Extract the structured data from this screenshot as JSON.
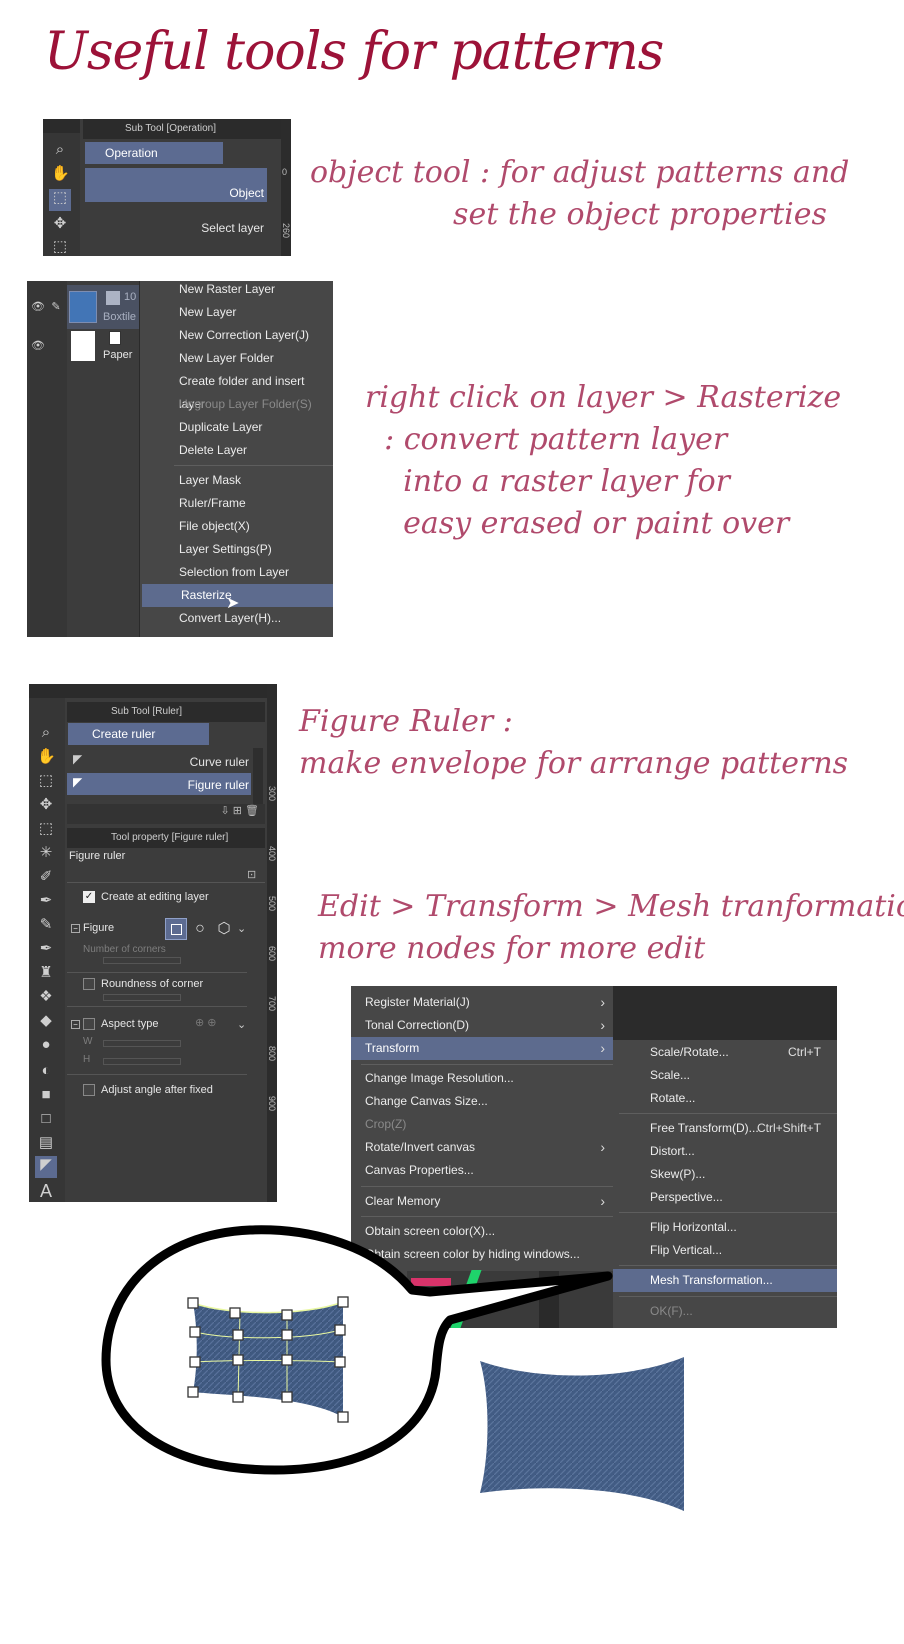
{
  "title": "Useful tools for patterns",
  "notes": {
    "object": "object tool : for adjust patterns and\n               set the object properties",
    "rasterize": "right click on layer > Rasterize\n  : convert pattern layer\n    into a raster layer for\n    easy erased or paint over",
    "figure": "Figure Ruler :\nmake envelope for arrange patterns",
    "mesh": "Edit > Transform > Mesh tranformation\nmore nodes for more edit"
  },
  "panel_object": {
    "header": "Sub Tool [Operation]",
    "group": "Operation",
    "items": [
      "Object",
      "Select layer"
    ],
    "ruler_marks": [
      "0",
      "260"
    ]
  },
  "panel_layers": {
    "layers": [
      {
        "name": "Boxtile",
        "extra": "10"
      },
      {
        "name": "Paper"
      }
    ],
    "menu": [
      "New Raster Layer",
      "New Layer",
      "New Correction Layer(J)",
      "New Layer Folder",
      "Create folder and insert layer",
      "Ungroup Layer Folder(S)",
      "Duplicate Layer",
      "Delete Layer",
      "Layer Mask",
      "Ruler/Frame",
      "File object(X)",
      "Layer Settings(P)",
      "Selection from Layer",
      "Rasterize",
      "Convert Layer(H)..."
    ]
  },
  "panel_ruler": {
    "header": "Sub Tool [Ruler]",
    "group": "Create ruler",
    "items": [
      "Curve ruler",
      "Figure ruler"
    ],
    "prop_header": "Tool property [Figure ruler]",
    "prop_title": "Figure ruler",
    "create_at_editing": "Create at editing layer",
    "figure_label": "Figure",
    "corners_label": "Number of corners",
    "roundness_label": "Roundness of corner",
    "aspect_label": "Aspect type",
    "w_label": "W",
    "h_label": "H",
    "adjust_label": "Adjust angle after fixed",
    "ruler_marks": [
      "300",
      "400",
      "500",
      "600",
      "700",
      "800",
      "900"
    ]
  },
  "edit_menu": {
    "left": [
      {
        "label": "Register Material(J)",
        "sub": true
      },
      {
        "label": "Tonal Correction(D)",
        "sub": true
      },
      {
        "label": "Transform",
        "sub": true,
        "hl": true
      },
      {
        "label": "Change Image Resolution..."
      },
      {
        "label": "Change Canvas Size..."
      },
      {
        "label": "Crop(Z)",
        "dis": true
      },
      {
        "label": "Rotate/Invert canvas",
        "sub": true
      },
      {
        "label": "Canvas Properties..."
      },
      {
        "label": "Clear Memory",
        "sub": true
      },
      {
        "label": "Obtain screen color(X)..."
      },
      {
        "label": "Obtain screen color by hiding windows..."
      }
    ],
    "right": [
      {
        "label": "Scale/Rotate...",
        "shortcut": "Ctrl+T"
      },
      {
        "label": "Scale..."
      },
      {
        "label": "Rotate..."
      },
      {
        "label": "Free Transform(D)...",
        "shortcut": "Ctrl+Shift+T"
      },
      {
        "label": "Distort..."
      },
      {
        "label": "Skew(P)..."
      },
      {
        "label": "Perspective..."
      },
      {
        "label": "Flip Horizontal..."
      },
      {
        "label": "Flip Vertical..."
      },
      {
        "label": "Mesh Transformation...",
        "hl": true
      },
      {
        "label": "OK(F)...",
        "dis": true
      }
    ]
  },
  "colors": {
    "title": "#9c1238",
    "note": "#b04a6c",
    "panel": "#3c3c3c",
    "selected": "#5c6b91",
    "denim": "#3f5980"
  }
}
